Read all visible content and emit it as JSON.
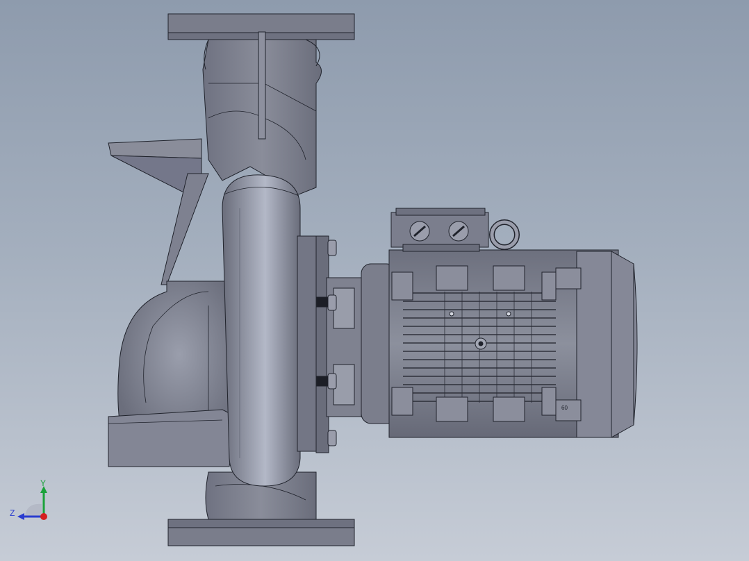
{
  "viewport": {
    "background_top": "#8e9bad",
    "background_bottom": "#c6ccd6",
    "model_body_color": "#868996",
    "model_edge_color": "#20232c",
    "model_highlight_color": "#b7bccb"
  },
  "triad": {
    "y_label": "Y",
    "z_label": "Z",
    "y_color": "#1aa23a",
    "z_color": "#2a3ccf",
    "x_color": "#d42020"
  },
  "motor": {
    "terminal_box_icons": [
      "cable-gland-icon",
      "cable-gland-icon"
    ],
    "lifting_eye": "lifting-eye-icon",
    "nameplate_marking": "60"
  }
}
